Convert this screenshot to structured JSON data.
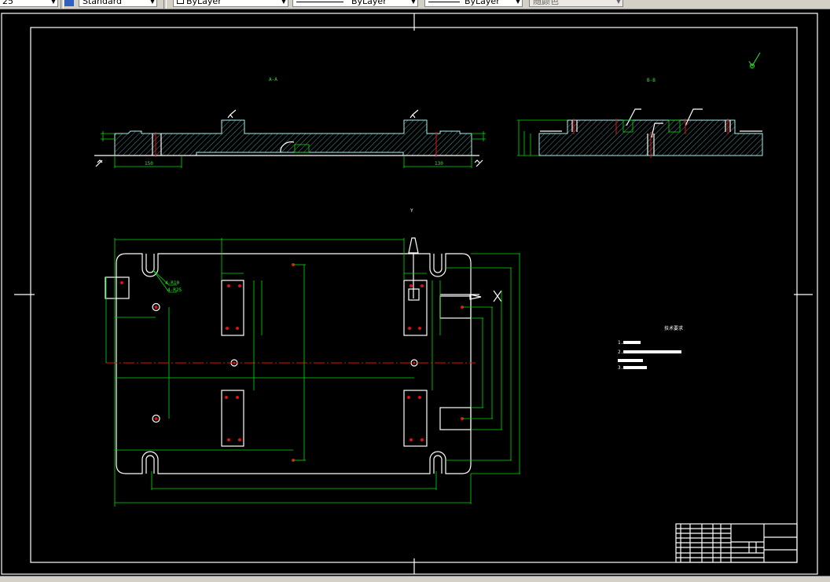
{
  "toolbar": {
    "scale_value": "25",
    "text_style": "Standard",
    "layer": "ByLayer",
    "linetype": "ByLayer",
    "lineweight": "ByLayer",
    "plot_style": "随颜色"
  },
  "drawing": {
    "section_a_label": "A-A",
    "section_b_label": "B-B",
    "axis_y_label": "Y",
    "axis_x_label": "X",
    "slot_radius_labels": [
      "4-R10",
      "4-R25"
    ],
    "section_a_dims": [
      "150",
      "130"
    ],
    "notes": {
      "title": "技术要求",
      "items": [
        "1.",
        "2.",
        "3."
      ]
    }
  },
  "colors": {
    "background": "#000000",
    "outline": "#ffffff",
    "dimension": "#00e000",
    "centerline": "#e01010",
    "hatch": "#a8f0f0"
  }
}
